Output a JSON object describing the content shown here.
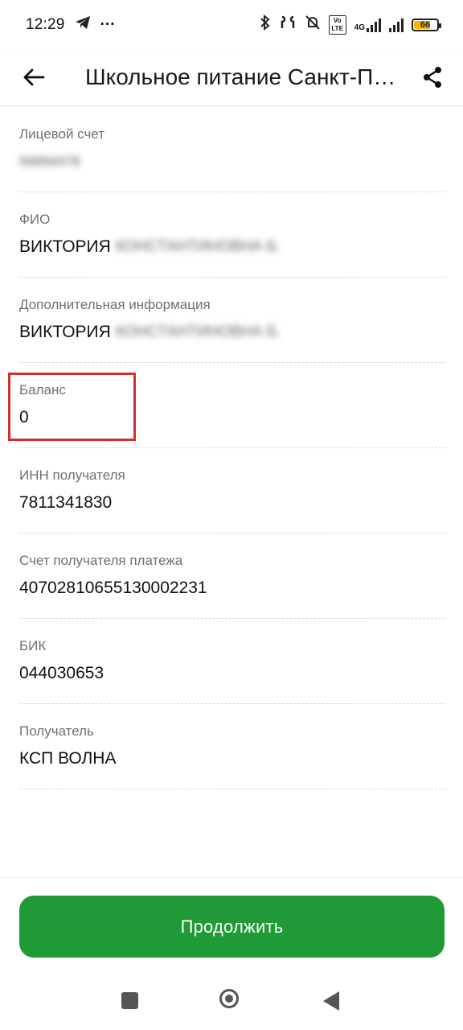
{
  "status_bar": {
    "time": "12:29",
    "more": "···",
    "network_label": "4G",
    "volte_label": "Vo LTE",
    "battery_level": "66"
  },
  "app_bar": {
    "title": "Школьное питание Санкт-Петербург"
  },
  "fields": [
    {
      "label": "Лицевой счет",
      "value": "56894478"
    },
    {
      "label": "ФИО",
      "value_visible": "ВИКТОРИЯ",
      "value_hidden": "КОНСТАНТИНОВНА Б."
    },
    {
      "label": "Дополнительная информация",
      "value_visible": "ВИКТОРИЯ",
      "value_hidden": "КОНСТАНТИНОВНА Б."
    },
    {
      "label": "Баланс",
      "value": "0"
    },
    {
      "label": "ИНН получателя",
      "value": "7811341830"
    },
    {
      "label": "Счет получателя платежа",
      "value": "40702810655130002231"
    },
    {
      "label": "БИК",
      "value": "044030653"
    },
    {
      "label": "Получатель",
      "value": "КСП ВОЛНА"
    }
  ],
  "actions": {
    "continue_label": "Продолжить"
  },
  "colors": {
    "primary_button": "#1f9a37",
    "highlight": "#d32f2f"
  }
}
